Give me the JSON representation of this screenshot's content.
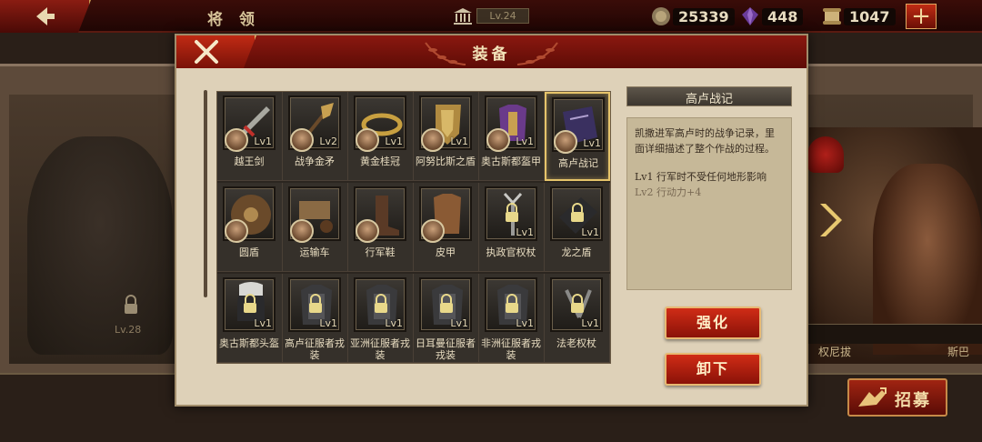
{
  "topbar": {
    "title": "将 领",
    "level": "Lv.24",
    "coins": "25339",
    "gems": "448",
    "scrolls": "1047"
  },
  "background": {
    "locked_hero_level": "Lv.28",
    "hero_name_1": "权尼拔",
    "hero_name_2": "斯巴",
    "recruit_label": "招募"
  },
  "modal": {
    "title": "装备",
    "detail": {
      "title": "高卢战记",
      "description": "凯撒进军高卢时的战争记录，里面详细描述了整个作战的过程。",
      "effects": [
        {
          "text": "Lv1  行军时不受任何地形影响",
          "active": true
        },
        {
          "text": "Lv2  行动力+4",
          "active": false
        }
      ]
    },
    "enhance_label": "强化",
    "unequip_label": "卸下",
    "items": [
      {
        "name": "越王剑",
        "level": "Lv1",
        "icon": "sword-icon",
        "state": "owned"
      },
      {
        "name": "战争金矛",
        "level": "Lv2",
        "icon": "spear-icon",
        "state": "owned"
      },
      {
        "name": "黄金桂冠",
        "level": "Lv1",
        "icon": "laurel-crown-icon",
        "state": "owned"
      },
      {
        "name": "阿努比斯之盾",
        "level": "Lv1",
        "icon": "shield-icon",
        "state": "owned"
      },
      {
        "name": "奥古斯都盔甲",
        "level": "Lv1",
        "icon": "armor-icon",
        "state": "owned"
      },
      {
        "name": "高卢战记",
        "level": "Lv1",
        "icon": "book-icon",
        "state": "owned",
        "selected": true
      },
      {
        "name": "圆盾",
        "level": "",
        "icon": "round-shield-icon",
        "state": "owned"
      },
      {
        "name": "运输车",
        "level": "",
        "icon": "cart-icon",
        "state": "owned"
      },
      {
        "name": "行军鞋",
        "level": "",
        "icon": "boots-icon",
        "state": "owned"
      },
      {
        "name": "皮甲",
        "level": "",
        "icon": "leather-armor-icon",
        "state": "owned"
      },
      {
        "name": "执政官权杖",
        "level": "Lv1",
        "icon": "scepter-icon",
        "state": "locked"
      },
      {
        "name": "龙之盾",
        "level": "Lv1",
        "icon": "dragon-shield-icon",
        "state": "locked"
      },
      {
        "name": "奥古斯都头盔",
        "level": "Lv1",
        "icon": "helmet-icon",
        "state": "locked"
      },
      {
        "name": "高卢征服者戎装",
        "level": "Lv1",
        "icon": "armor-set-icon",
        "state": "locked"
      },
      {
        "name": "亚洲征服者戎装",
        "level": "Lv1",
        "icon": "armor-set-icon",
        "state": "locked"
      },
      {
        "name": "日耳曼征服者戎装",
        "level": "Lv1",
        "icon": "armor-set-icon",
        "state": "locked"
      },
      {
        "name": "非洲征服者戎装",
        "level": "Lv1",
        "icon": "armor-set-icon",
        "state": "locked"
      },
      {
        "name": "法老权杖",
        "level": "Lv1",
        "icon": "flail-icon",
        "state": "locked"
      }
    ]
  },
  "colors": {
    "accent_red": "#a01c10",
    "gold": "#e6c46a",
    "parchment": "#ded1b8"
  }
}
